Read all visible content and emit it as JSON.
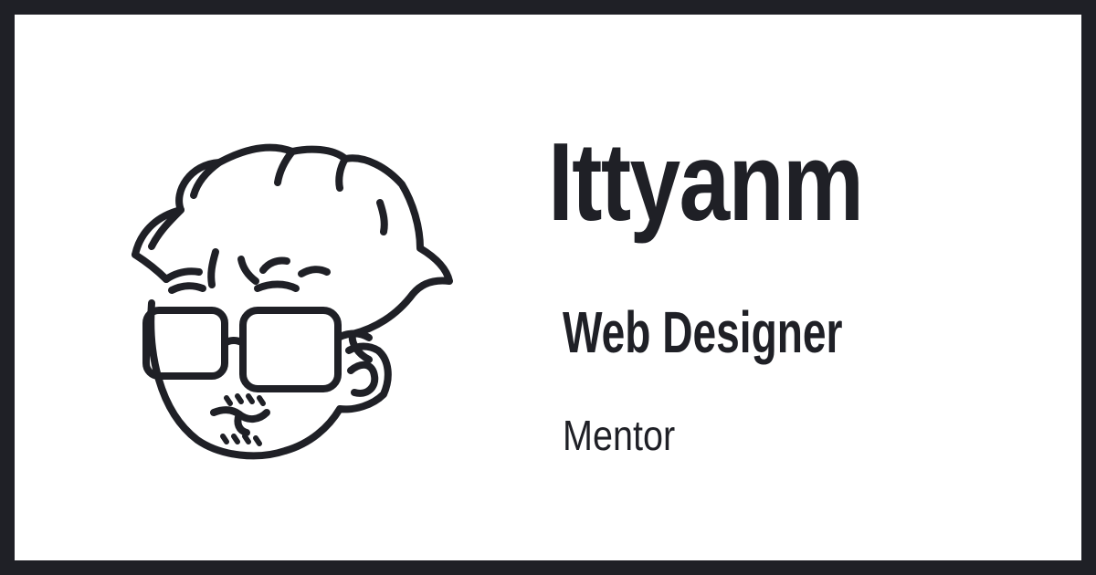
{
  "profile": {
    "name": "Ittyanm",
    "role": "Web Designer",
    "subtitle": "Mentor"
  },
  "colors": {
    "frame": "#1f2026",
    "background": "#ffffff",
    "text": "#1f2026"
  },
  "icons": {
    "avatar": "avatar-illustration"
  }
}
